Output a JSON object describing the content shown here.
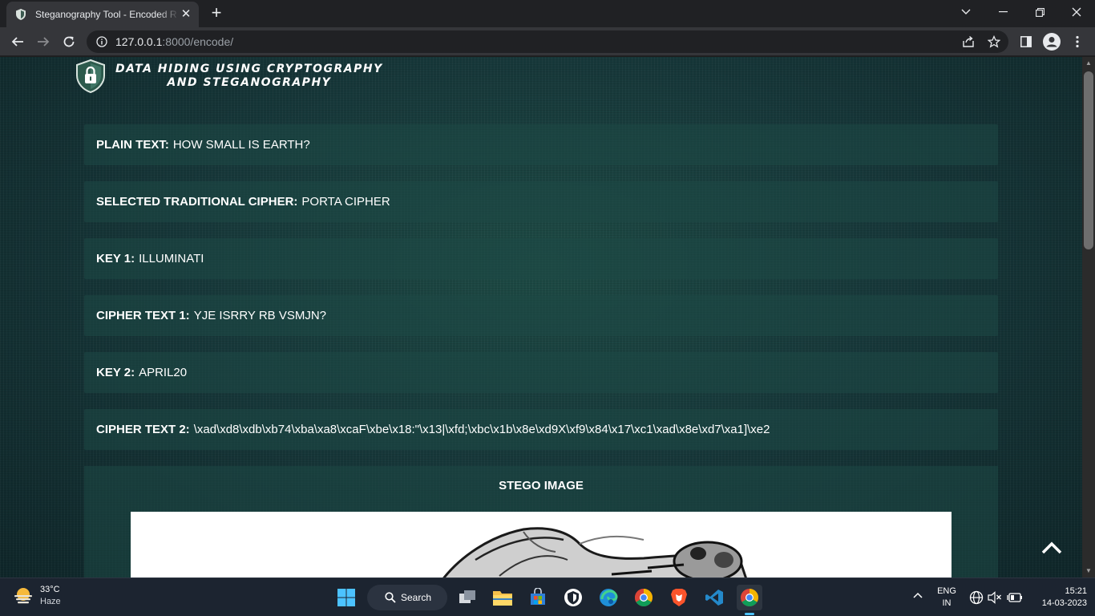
{
  "browser": {
    "tab_title": "Steganography Tool - Encoded R",
    "url_host": "127.0.0.1",
    "url_rest": ":8000/encode/"
  },
  "page": {
    "brand_line1": "DATA HIDING USING CRYPTOGRAPHY",
    "brand_line2": "AND STEGANOGRAPHY",
    "fields": [
      {
        "label": "PLAIN TEXT:",
        "value": "HOW SMALL IS EARTH?"
      },
      {
        "label": "SELECTED TRADITIONAL CIPHER:",
        "value": "PORTA CIPHER"
      },
      {
        "label": "KEY 1:",
        "value": "ILLUMINATI"
      },
      {
        "label": "CIPHER TEXT 1:",
        "value": "YJE ISRRY RB VSMJN?"
      },
      {
        "label": "KEY 2:",
        "value": "APRIL20"
      },
      {
        "label": "CIPHER TEXT 2:",
        "value": "\\xad\\xd8\\xdb\\xb74\\xba\\xa8\\xcaF\\xbe\\x18:\"\\x13|\\xfd;\\xbc\\x1b\\x8e\\xd9X\\xf9\\x84\\x17\\xc1\\xad\\x8e\\xd7\\xa1]\\xe2"
      }
    ],
    "stego_title": "STEGO IMAGE"
  },
  "taskbar": {
    "temperature": "33°C",
    "weather": "Haze",
    "search_label": "Search",
    "lang": "ENG",
    "region": "IN",
    "time": "15:21",
    "date": "14-03-2023"
  }
}
